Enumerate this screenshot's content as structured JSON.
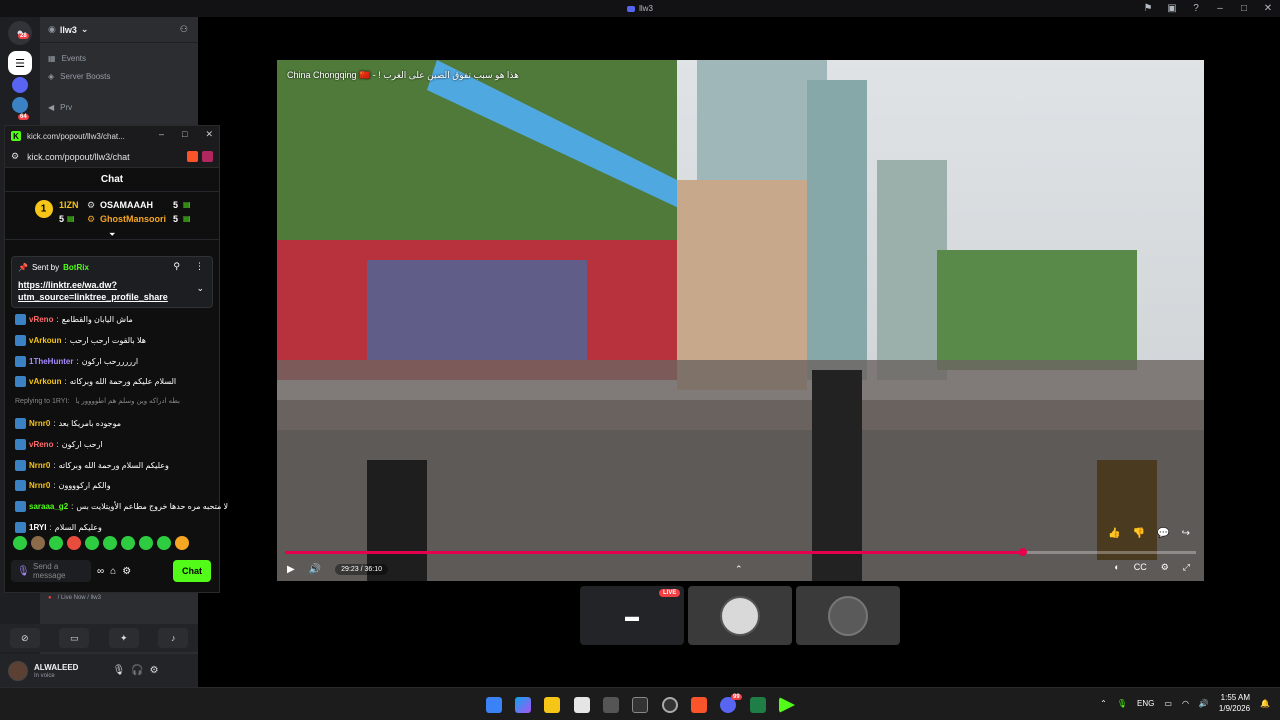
{
  "window": {
    "title": "llw3"
  },
  "server": {
    "name": "llw3"
  },
  "sidebar": {
    "channels": [
      {
        "label": "Events"
      },
      {
        "label": "Server Boosts"
      },
      {
        "label": "Prv"
      }
    ],
    "rail_badges": [
      "28",
      "64"
    ],
    "voice_status": "/ Live Now / llw3"
  },
  "user": {
    "name": "ALWALEED",
    "status": "In voice"
  },
  "popup": {
    "title": "kick.com/popout/llw3/chat...",
    "url": "kick.com/popout/llw3/chat",
    "chat_header": "Chat",
    "gifters": [
      {
        "rank": "1",
        "name": "1IZN",
        "count": "5"
      },
      {
        "name": "OSAMAAAH",
        "count": "5"
      },
      {
        "name": "GhostMansoori",
        "count": "5"
      }
    ],
    "pinned": {
      "sent_by": "Sent by",
      "bot": "BotRix",
      "link": "https://linktr.ee/wa.dw?utm_source=linktree_profile_share"
    },
    "messages": [
      {
        "user": "vReno",
        "text": "ماش اليابان والقطامع",
        "color": "#ff6b6b"
      },
      {
        "user": "vArkoun",
        "text": "هلا بالقوت ارحب ارحب",
        "color": "#f5c518"
      },
      {
        "user": "1TheHunter",
        "text": "ارررررحب اركون",
        "color": "#a78bfa"
      },
      {
        "user": "vArkoun",
        "text": "السلام عليكم ورحمة الله وبركاته",
        "color": "#f5c518"
      },
      {
        "user": "Replying to 1RYI:",
        "text": "بطه ادراكه وين وسلم هم اطوووور يا",
        "color": "#888888"
      },
      {
        "user": "Nrnr0",
        "text": "موجوده بامريكا بعد",
        "color": "#f5c518"
      },
      {
        "user": "vReno",
        "text": "ارحب اركون",
        "color": "#ff6b6b"
      },
      {
        "user": "Nrnr0",
        "text": "وعليكم السلام ورحمة الله وبركاته",
        "color": "#f5c518"
      },
      {
        "user": "Nrnr0",
        "text": "والكم اركوووون",
        "color": "#f5c518"
      },
      {
        "user": "saraaa_g2",
        "text": "لا متحبه مره حدها خروج مطاعم الأويتلايت بس",
        "color": "#53fc18"
      },
      {
        "user": "1RYI",
        "text": "وعليكم السلام",
        "color": "#ffffff"
      }
    ],
    "input_placeholder": "Send a message",
    "chat_button": "Chat"
  },
  "video": {
    "title": "China Chongqing 🇨🇳 - ! هذا هو سبب تفوق الصين على الغرب",
    "time": "29:23 / 36:10",
    "progress": 0.81
  },
  "tiles": {
    "live_badge": "LIVE"
  },
  "taskbar": {
    "lang": "ENG",
    "time": "1:55 AM",
    "date": "1/9/2026",
    "discord_badge": "99"
  }
}
